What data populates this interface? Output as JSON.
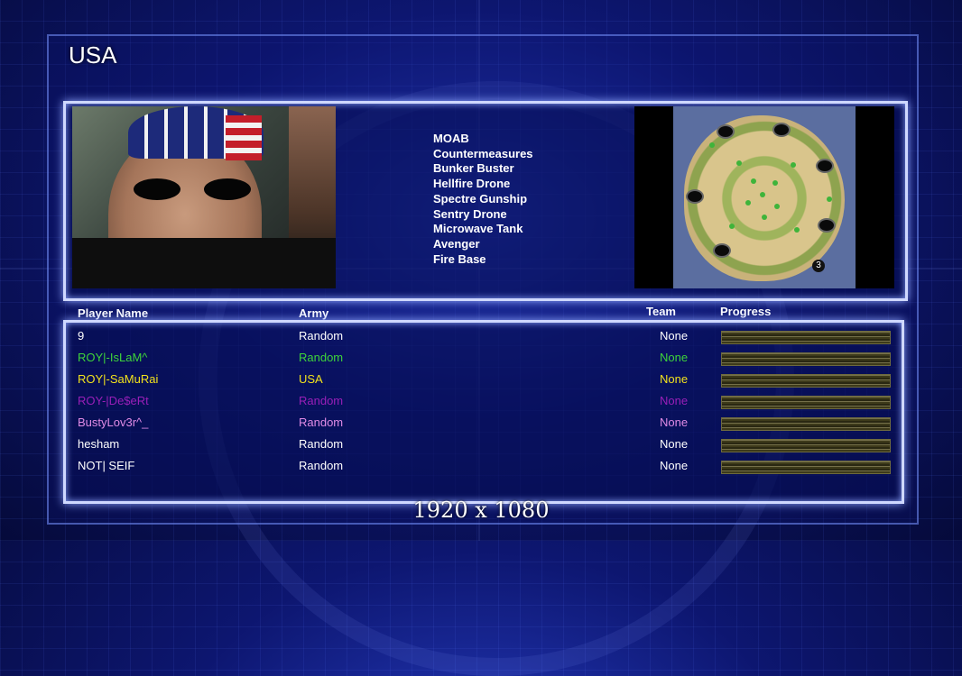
{
  "screen": {
    "title": "USA",
    "caption": "1920 x 1080"
  },
  "powers": [
    "MOAB",
    "Countermeasures",
    "Bunker Buster",
    "Hellfire Drone",
    "Spectre Gunship",
    "Sentry Drone",
    "Microwave Tank",
    "Avenger",
    "Fire Base"
  ],
  "minimap": {
    "player_marker": "3"
  },
  "table": {
    "headers": {
      "player": "Player Name",
      "army": "Army",
      "team": "Team",
      "progress": "Progress"
    },
    "rows": [
      {
        "name": "9",
        "army": "Random",
        "team": "None",
        "color": "#ffffff"
      },
      {
        "name": "ROY|-IsLaM^",
        "army": "Random",
        "team": "None",
        "color": "#3ed43a"
      },
      {
        "name": "ROY|-SaMuRai",
        "army": "USA",
        "team": "None",
        "color": "#f2e21c"
      },
      {
        "name": "ROY-|De$eRt",
        "army": "Random",
        "team": "None",
        "color": "#9a1fb8"
      },
      {
        "name": "BustyLov3r^_",
        "army": "Random",
        "team": "None",
        "color": "#e08be6"
      },
      {
        "name": "hesham",
        "army": "Random",
        "team": "None",
        "color": "#ffffff"
      },
      {
        "name": "NOT| SEIF",
        "army": "Random",
        "team": "None",
        "color": "#ffffff"
      }
    ]
  },
  "colors": {
    "frame_glow": "#8fa6ff",
    "background": "#0d1670"
  }
}
